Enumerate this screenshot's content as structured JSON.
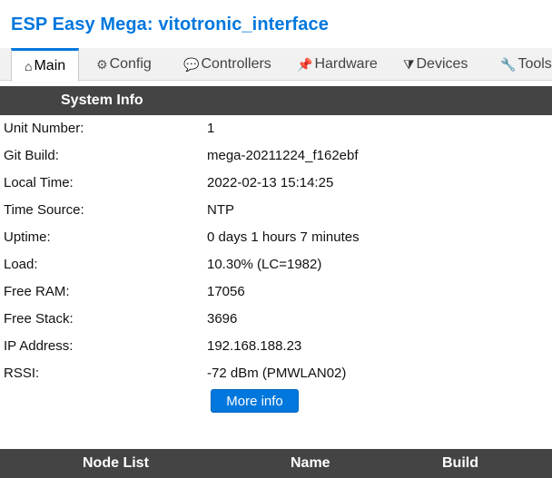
{
  "app": {
    "title": "ESP Easy Mega: vitotronic_interface"
  },
  "tabs": [
    {
      "icon": "home-icon",
      "glyph": "⌂",
      "label": "Main",
      "active": true
    },
    {
      "icon": "gear-icon",
      "glyph": "⚙",
      "label": "Config"
    },
    {
      "icon": "chat-icon",
      "glyph": "💬",
      "label": "Controllers"
    },
    {
      "icon": "pushpin-icon",
      "glyph": "📌",
      "label": "Hardware"
    },
    {
      "icon": "plug-icon",
      "glyph": "⧩",
      "label": "Devices"
    },
    {
      "icon": "wrench-icon",
      "glyph": "🔧",
      "label": "Tools"
    }
  ],
  "system_info": {
    "header": "System Info",
    "rows": [
      {
        "label": "Unit Number:",
        "value": "1"
      },
      {
        "label": "Git Build:",
        "value": "mega-20211224_f162ebf"
      },
      {
        "label": "Local Time:",
        "value": "2022-02-13 15:14:25"
      },
      {
        "label": "Time Source:",
        "value": "NTP"
      },
      {
        "label": "Uptime:",
        "value": "0 days 1 hours 7 minutes"
      },
      {
        "label": "Load:",
        "value": "10.30% (LC=1982)"
      },
      {
        "label": "Free RAM:",
        "value": "17056"
      },
      {
        "label": "Free Stack:",
        "value": "3696"
      },
      {
        "label": "IP Address:",
        "value": "192.168.188.23"
      },
      {
        "label": "RSSI:",
        "value": "-72 dBm (PMWLAN02)"
      }
    ],
    "more_info_label": "More info"
  },
  "node_list": {
    "col_node": "Node List",
    "col_name": "Name",
    "col_build": "Build"
  },
  "colors": {
    "accent": "#0077DD",
    "header_bg": "#444444"
  }
}
